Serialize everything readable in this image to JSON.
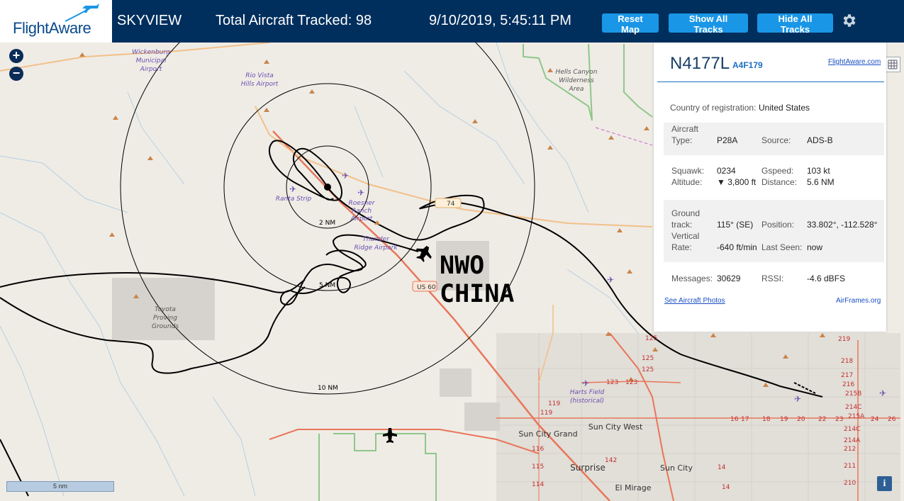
{
  "header": {
    "logo_text": "FlightAware",
    "app_name": "SKYVIEW",
    "total_tracked_label": "Total Aircraft Tracked: 98",
    "datetime": "9/10/2019, 5:45:11 PM",
    "buttons": {
      "reset_map": "Reset Map",
      "show_all_tracks": "Show All Tracks",
      "hide_all_tracks": "Hide All Tracks"
    },
    "settings_icon": "gear-icon"
  },
  "map": {
    "zoom_in": "+",
    "zoom_out": "−",
    "scale_label": "5 nm",
    "info_label": "i",
    "overlay_text": [
      "NWO",
      "CHINA"
    ],
    "range_labels": [
      "2 NM",
      "5 NM",
      "10 NM"
    ],
    "places": [
      "Wickenburg",
      "Municipal",
      "Airport",
      "Rio Vista",
      "Hills Airport",
      "Hells Canyon",
      "Wilderness",
      "Area",
      "Ranta Strip",
      "Roesner",
      "Ranch",
      "Airport",
      "Thunder",
      "Ridge Airpark",
      "Toyota",
      "Proving",
      "Grounds",
      "Harts Field",
      "(historical)",
      "Sun City Grand",
      "Sun City West",
      "Surprise",
      "Sun City",
      "El Mirage"
    ],
    "road_labels": [
      "US 60",
      "74"
    ],
    "exit_numbers": [
      "125",
      "125",
      "125",
      "123",
      "123",
      "119",
      "119",
      "116",
      "115",
      "114",
      "142",
      "219",
      "218",
      "217",
      "216",
      "215B",
      "214C",
      "215A",
      "214C",
      "214A",
      "212",
      "211",
      "210",
      "14",
      "14",
      "17",
      "16",
      "18",
      "19",
      "20",
      "22",
      "23",
      "24",
      "26"
    ]
  },
  "panel": {
    "ident": "N4177L",
    "hex": "A4F179",
    "link_text": "FlightAware.com",
    "country_label": "Country of registration:",
    "country_value": "United States",
    "aircraft_type_label_1": "Aircraft",
    "aircraft_type_label_2": "Type:",
    "aircraft_type_value": "P28A",
    "source_label": "Source:",
    "source_value": "ADS-B",
    "squawk_label": "Squawk:",
    "squawk_value": "0234",
    "gspeed_label": "Gspeed:",
    "gspeed_value": "103 kt",
    "altitude_label": "Altitude:",
    "altitude_value": "▼ 3,800 ft",
    "distance_label": "Distance:",
    "distance_value": "5.6 NM",
    "ground_label_1": "Ground",
    "ground_label_2": "track:",
    "ground_value": "115° (SE)",
    "position_label": "Position:",
    "position_value": "33.802°, -112.528°",
    "vrate_label_1": "Vertical",
    "vrate_label_2": "Rate:",
    "vrate_value": "-640 ft/min",
    "lastseen_label": "Last Seen:",
    "lastseen_value": "now",
    "messages_label": "Messages:",
    "messages_value": "30629",
    "rssi_label": "RSSI:",
    "rssi_value": "-4.6 dBFS",
    "photos_link": "See Aircraft Photos",
    "airframes_link": "AirFrames.org"
  },
  "colors": {
    "header_bg": "#002f5d",
    "button_bg": "#1a96e6",
    "map_bg": "#efece6",
    "track": "#000000",
    "highway": "#e8765a",
    "secondary_road": "#f2c089",
    "park_border": "#8fc78a",
    "panel_accent": "#1a74c4"
  }
}
